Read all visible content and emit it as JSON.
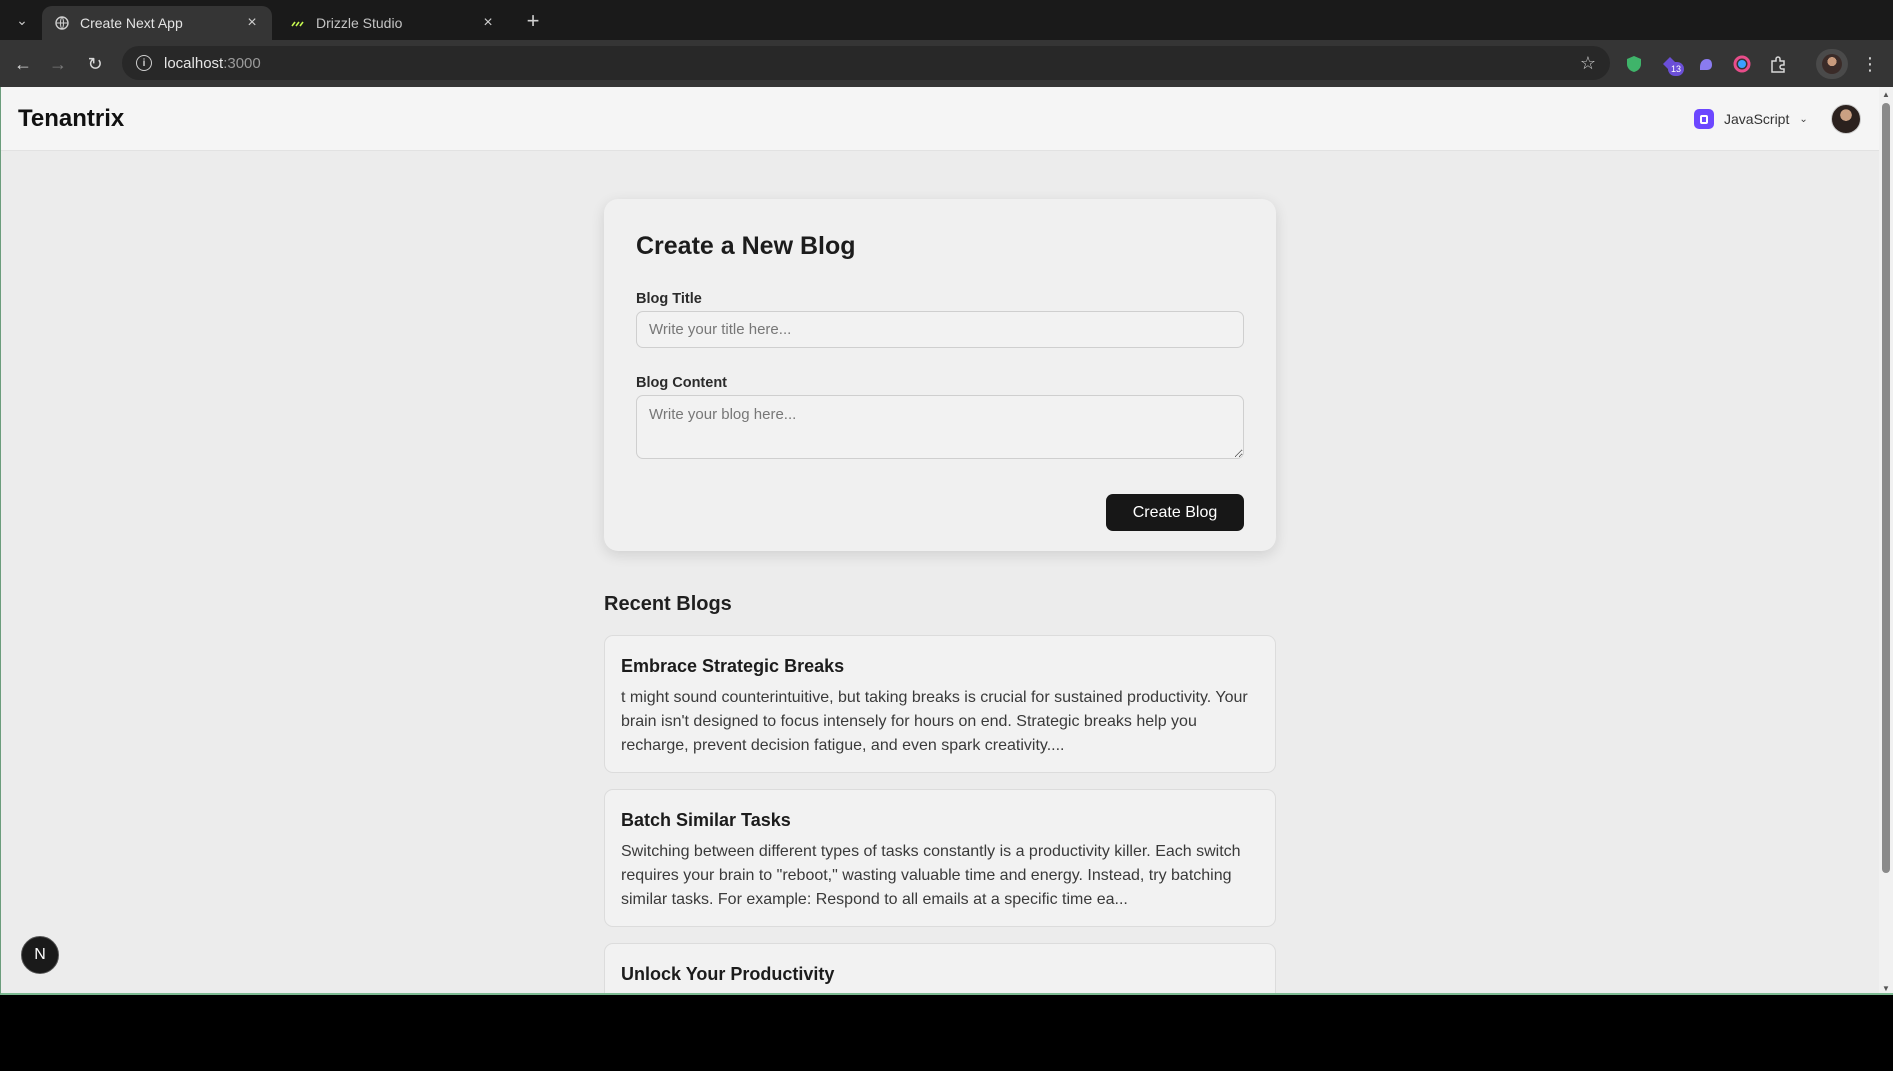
{
  "browser": {
    "tabs": [
      {
        "title": "Create Next App",
        "active": true,
        "favicon": "globe-icon"
      },
      {
        "title": "Drizzle Studio",
        "active": false,
        "favicon": "drizzle-icon"
      }
    ],
    "url_host": "localhost",
    "url_port": ":3000",
    "extension_badge": "13"
  },
  "header": {
    "brand": "Tenantrix",
    "org_name": "JavaScript"
  },
  "create_form": {
    "heading": "Create a New Blog",
    "title_label": "Blog Title",
    "title_placeholder": "Write your title here...",
    "title_value": "",
    "content_label": "Blog Content",
    "content_placeholder": "Write your blog here...",
    "content_value": "",
    "submit_label": "Create Blog"
  },
  "recent": {
    "heading": "Recent Blogs",
    "posts": [
      {
        "title": "Embrace Strategic Breaks",
        "excerpt": "t might sound counterintuitive, but taking breaks is crucial for sustained productivity. Your brain isn't designed to focus intensely for hours on end. Strategic breaks help you recharge, prevent decision fatigue, and even spark creativity...."
      },
      {
        "title": "Batch Similar Tasks",
        "excerpt": "Switching between different types of tasks constantly is a productivity killer. Each switch requires your brain to \"reboot,\" wasting valuable time and energy. Instead, try batching similar tasks. For example: Respond to all emails at a specific time ea..."
      },
      {
        "title": "Unlock Your Productivity",
        "excerpt": ""
      }
    ]
  },
  "dev_badge": "N",
  "colors": {
    "primary_button": "#171717",
    "org_logo": "#6c47ff",
    "page_background": "#ececec"
  }
}
